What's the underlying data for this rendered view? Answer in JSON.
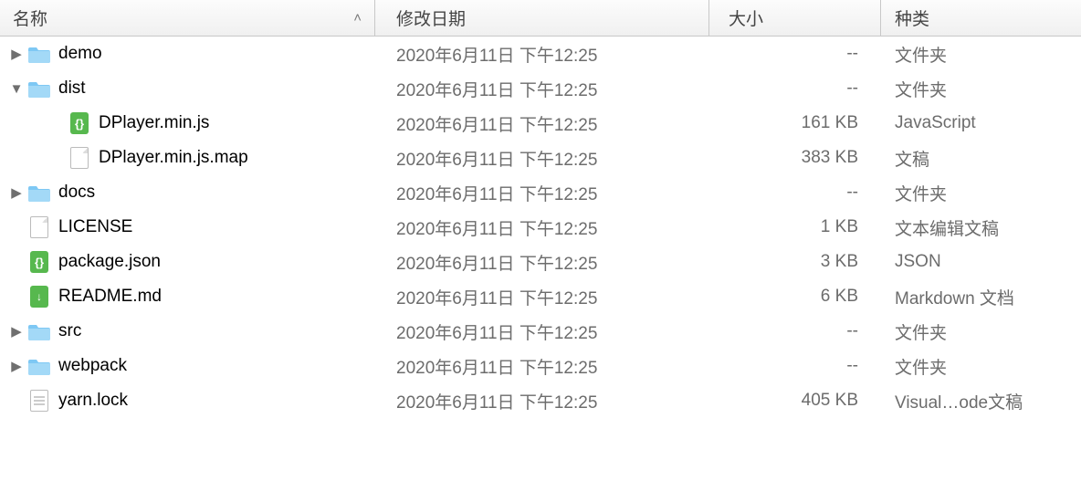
{
  "columns": {
    "name": "名称",
    "date": "修改日期",
    "size": "大小",
    "kind": "种类"
  },
  "rows": [
    {
      "disclosure": "right",
      "indent": 0,
      "icon": "folder",
      "name": "demo",
      "date": "2020年6月11日 下午12:25",
      "size": "--",
      "kind": "文件夹"
    },
    {
      "disclosure": "down",
      "indent": 0,
      "icon": "folder",
      "name": "dist",
      "date": "2020年6月11日 下午12:25",
      "size": "--",
      "kind": "文件夹"
    },
    {
      "disclosure": "none",
      "indent": 1,
      "icon": "json",
      "name": "DPlayer.min.js",
      "date": "2020年6月11日 下午12:25",
      "size": "161 KB",
      "kind": "JavaScript"
    },
    {
      "disclosure": "none",
      "indent": 1,
      "icon": "blank",
      "name": "DPlayer.min.js.map",
      "date": "2020年6月11日 下午12:25",
      "size": "383 KB",
      "kind": "文稿"
    },
    {
      "disclosure": "right",
      "indent": 0,
      "icon": "folder",
      "name": "docs",
      "date": "2020年6月11日 下午12:25",
      "size": "--",
      "kind": "文件夹"
    },
    {
      "disclosure": "none",
      "indent": 0,
      "icon": "blank",
      "name": "LICENSE",
      "date": "2020年6月11日 下午12:25",
      "size": "1 KB",
      "kind": "文本编辑文稿"
    },
    {
      "disclosure": "none",
      "indent": 0,
      "icon": "json",
      "name": "package.json",
      "date": "2020年6月11日 下午12:25",
      "size": "3 KB",
      "kind": "JSON"
    },
    {
      "disclosure": "none",
      "indent": 0,
      "icon": "md",
      "name": "README.md",
      "date": "2020年6月11日 下午12:25",
      "size": "6 KB",
      "kind": "Markdown 文档"
    },
    {
      "disclosure": "right",
      "indent": 0,
      "icon": "folder",
      "name": "src",
      "date": "2020年6月11日 下午12:25",
      "size": "--",
      "kind": "文件夹"
    },
    {
      "disclosure": "right",
      "indent": 0,
      "icon": "folder",
      "name": "webpack",
      "date": "2020年6月11日 下午12:25",
      "size": "--",
      "kind": "文件夹"
    },
    {
      "disclosure": "none",
      "indent": 0,
      "icon": "text",
      "name": "yarn.lock",
      "date": "2020年6月11日 下午12:25",
      "size": "405 KB",
      "kind": "Visual…ode文稿"
    }
  ]
}
